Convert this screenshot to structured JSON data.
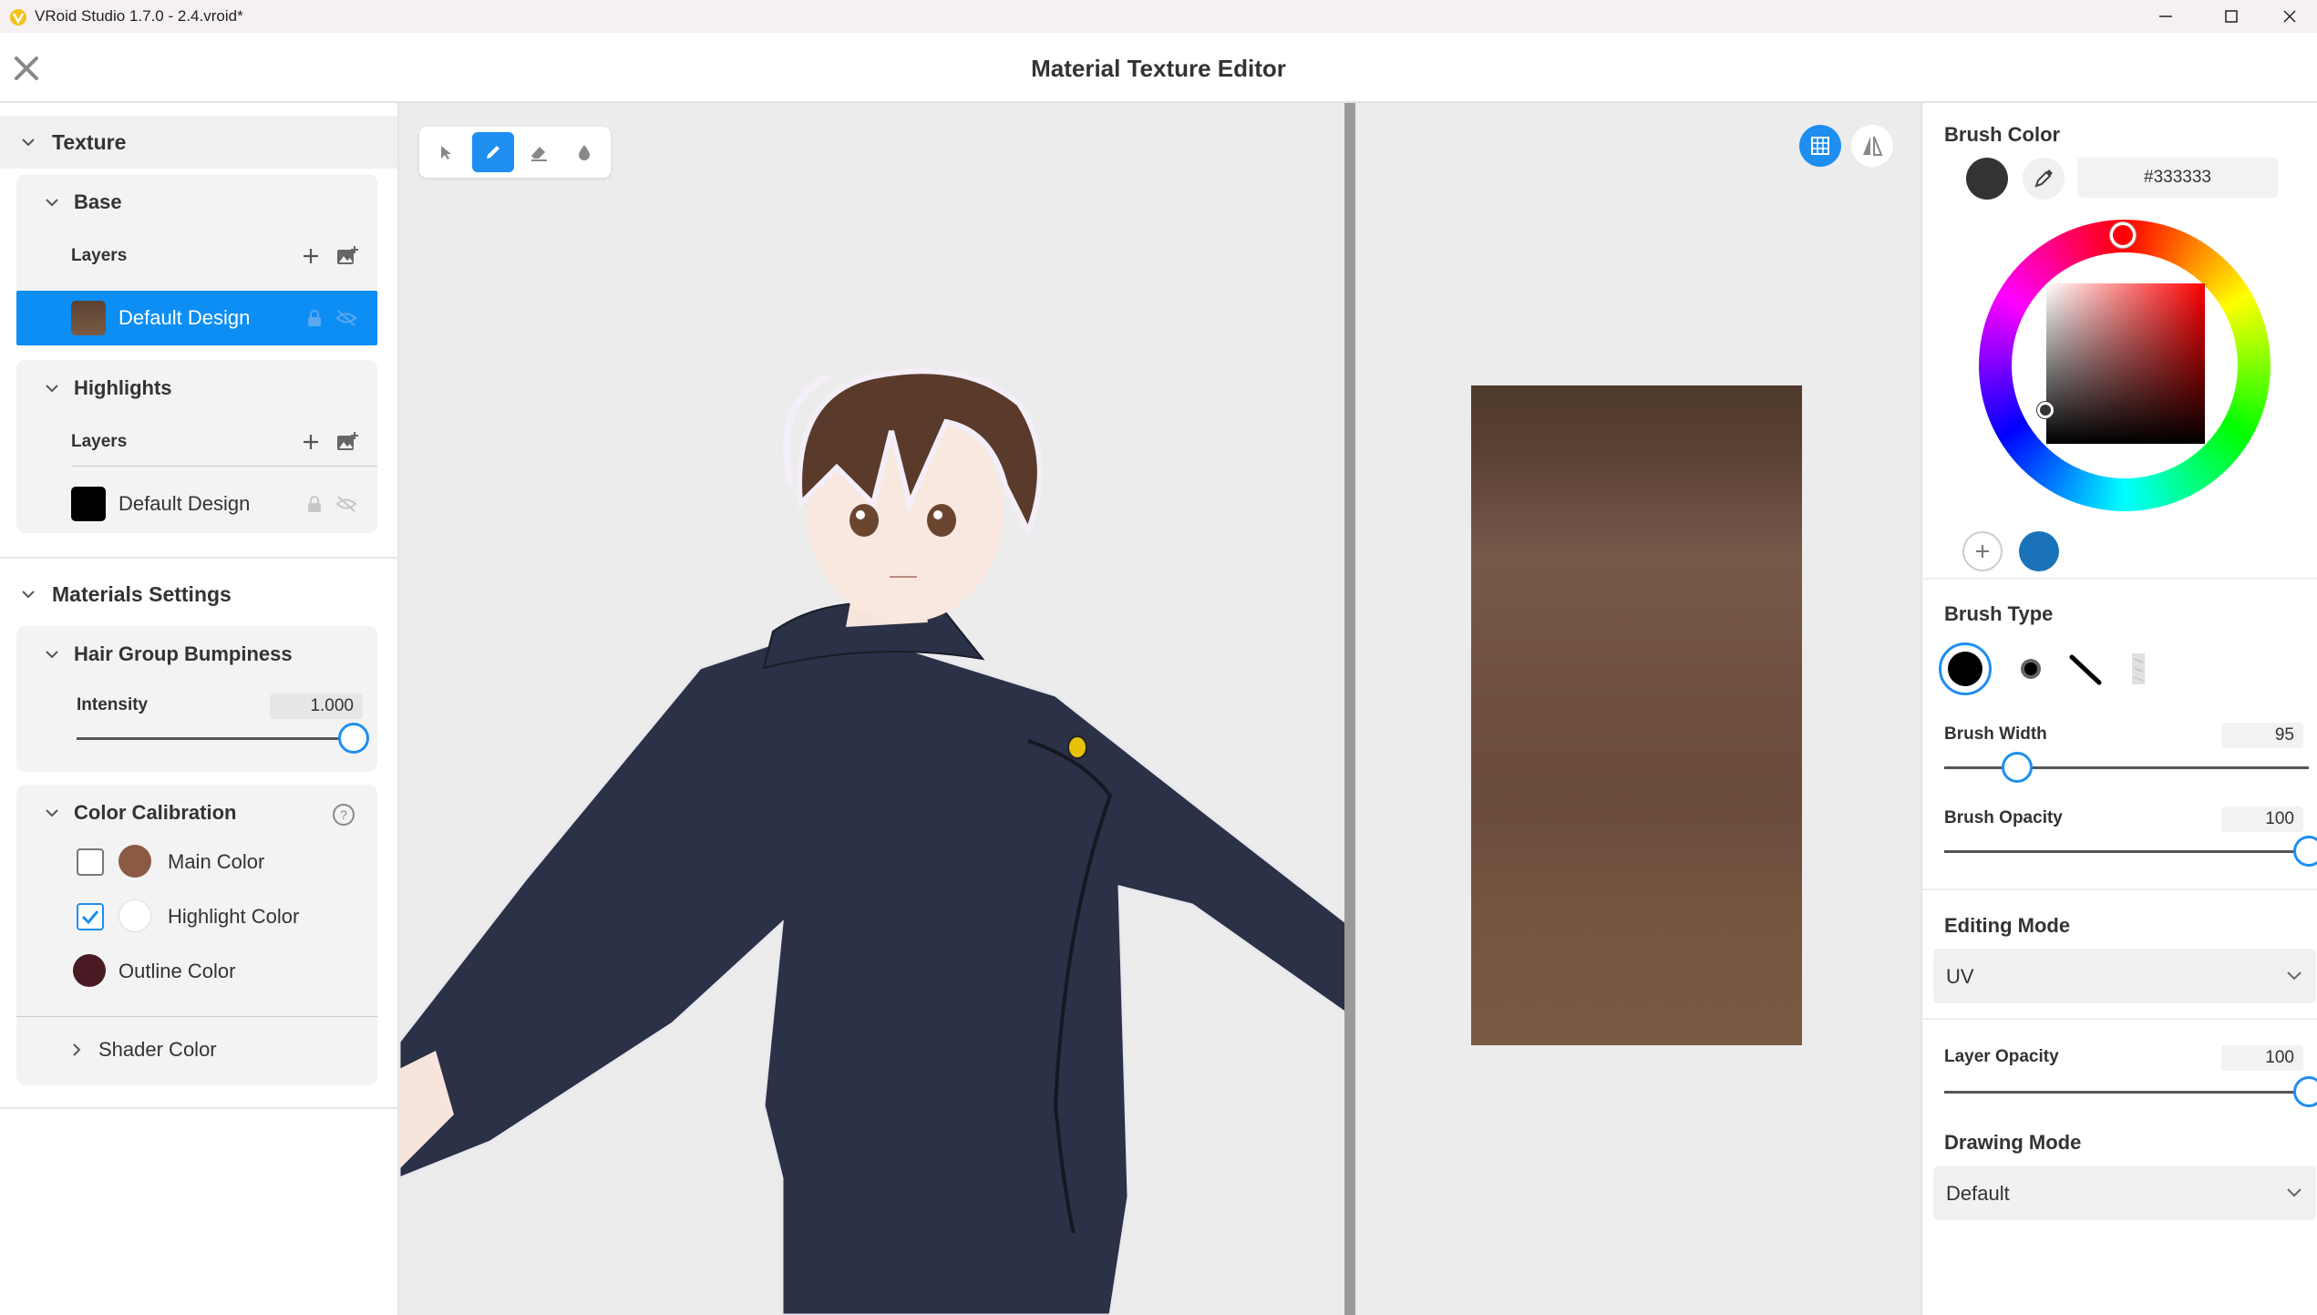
{
  "window": {
    "title": "VRoid Studio 1.7.0 - 2.4.vroid*"
  },
  "header": {
    "title": "Material Texture Editor"
  },
  "left": {
    "texture_section": "Texture",
    "base": {
      "title": "Base",
      "layers_label": "Layers",
      "layer_name": "Default Design"
    },
    "highlights": {
      "title": "Highlights",
      "layers_label": "Layers",
      "layer_name": "Default Design"
    },
    "materials_section": "Materials Settings",
    "hair_bump": {
      "title": "Hair Group Bumpiness",
      "intensity_label": "Intensity",
      "intensity_value": "1.000",
      "intensity_fraction": 1.0
    },
    "color_cal": {
      "title": "Color Calibration",
      "items": [
        {
          "label": "Main Color",
          "checked": false,
          "swatch": "#8a5a42"
        },
        {
          "label": "Highlight Color",
          "checked": true,
          "swatch": "#ffffff"
        },
        {
          "label": "Outline Color",
          "swatch": "#4a1a24"
        }
      ],
      "shader": "Shader Color"
    }
  },
  "viewport": {
    "tools": [
      "select-tool",
      "pen-tool",
      "eraser-tool",
      "fill-tool"
    ],
    "active_tool": "pen-tool"
  },
  "right": {
    "brush_color_title": "Brush Color",
    "brush_color_hex": "#333333",
    "swatch_color": "#333333",
    "saved_color": "#1a73b8",
    "brush_type_title": "Brush Type",
    "brush_width_label": "Brush Width",
    "brush_width_value": "95",
    "brush_width_fraction": 0.2,
    "brush_opacity_label": "Brush Opacity",
    "brush_opacity_value": "100",
    "brush_opacity_fraction": 1.0,
    "editing_mode_title": "Editing Mode",
    "editing_mode_value": "UV",
    "layer_opacity_label": "Layer Opacity",
    "layer_opacity_value": "100",
    "layer_opacity_fraction": 1.0,
    "drawing_mode_title": "Drawing Mode",
    "drawing_mode_value": "Default"
  },
  "colors": {
    "accent": "#1e8ef0",
    "selected_row": "#0d8ef5"
  }
}
